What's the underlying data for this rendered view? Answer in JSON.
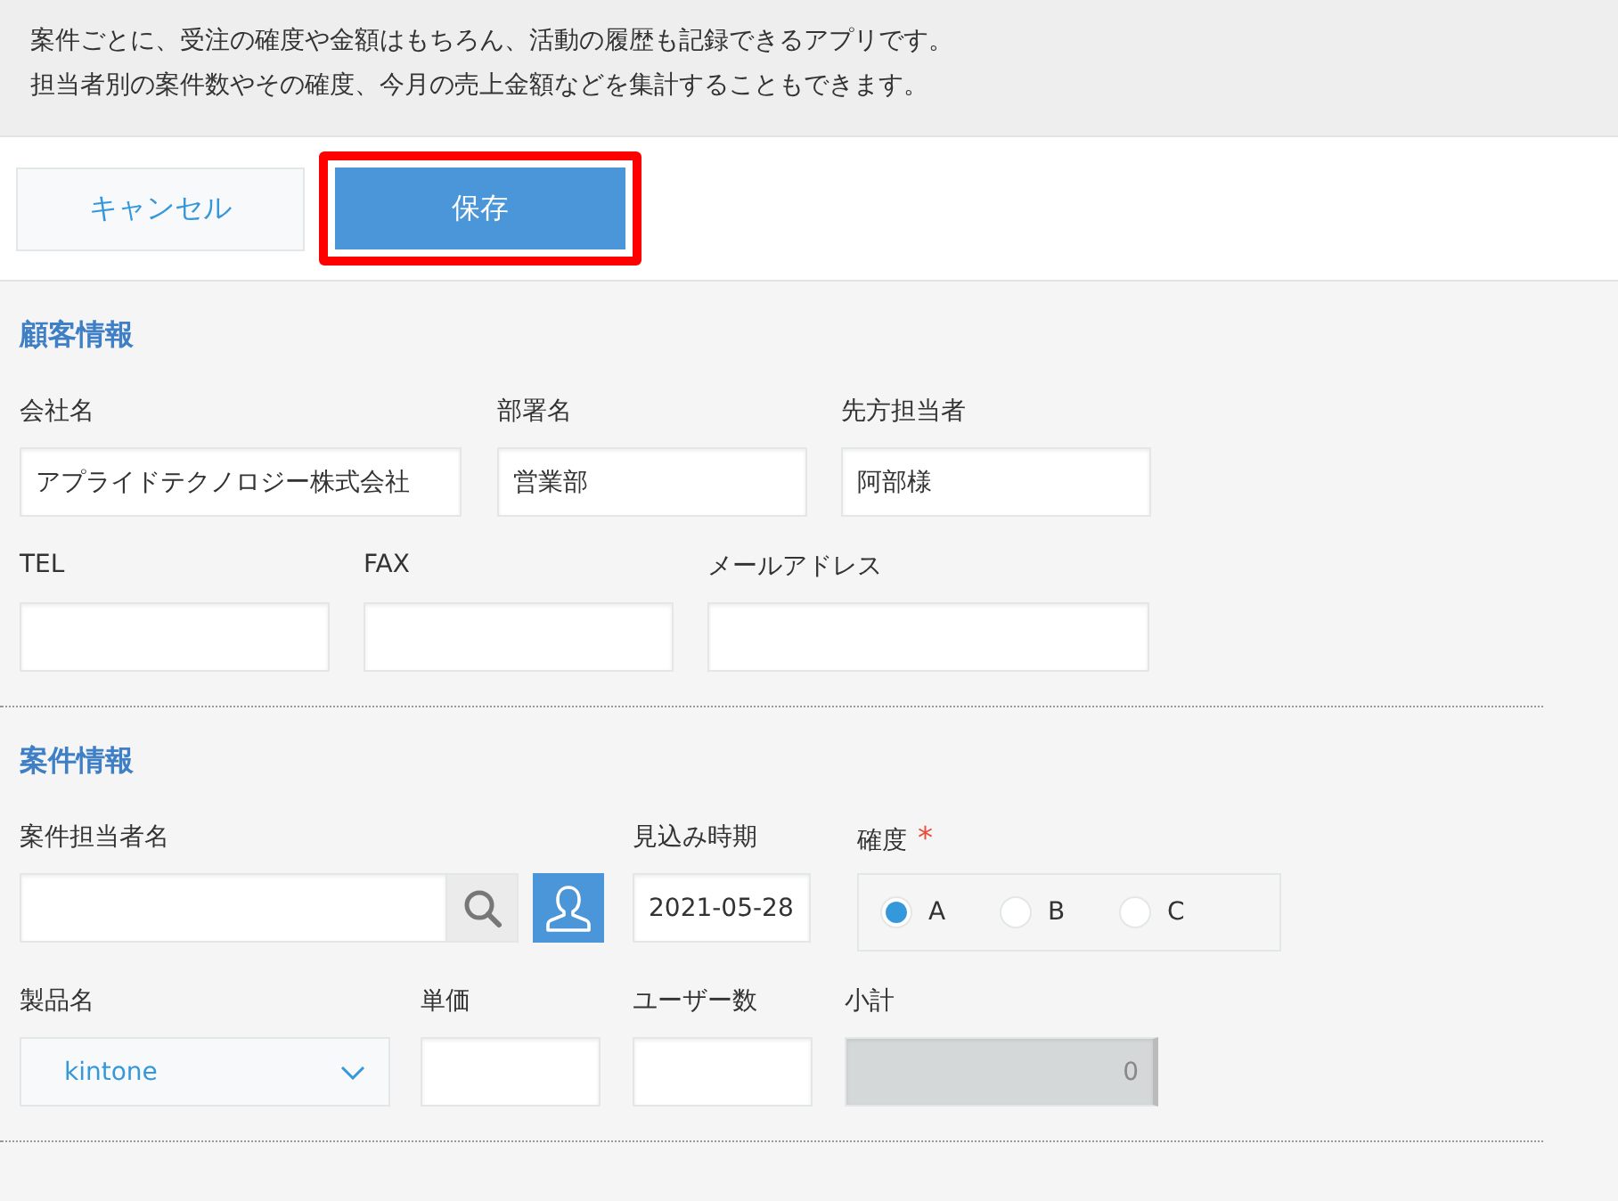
{
  "description": [
    "案件ごとに、受注の確度や金額はもちろん、活動の履歴も記録できるアプリです。",
    "担当者別の案件数やその確度、今月の売上金額などを集計することもできます。"
  ],
  "toolbar": {
    "cancel": "キャンセル",
    "save": {
      "label": "保存",
      "highlighted": true
    }
  },
  "sections": [
    {
      "title": "顧客情報",
      "groups": [
        {
          "fields": [
            {
              "kind": "text",
              "label": "会社名",
              "value": "アプライドテクノロジー株式会社"
            },
            {
              "kind": "text",
              "label": "部署名",
              "value": "営業部"
            },
            {
              "kind": "text",
              "label": "先方担当者",
              "value": "阿部様"
            }
          ]
        },
        {
          "fields": [
            {
              "kind": "text",
              "label": "TEL"
            },
            {
              "kind": "text",
              "label": "FAX"
            },
            {
              "kind": "text",
              "label": "メールアドレス"
            }
          ]
        }
      ]
    },
    {
      "title": "案件情報",
      "groups": [
        {
          "fields": [
            {
              "kind": "user",
              "label": "案件担当者名"
            },
            {
              "kind": "date",
              "label": "見込み時期",
              "value": "2021-05-28"
            },
            {
              "kind": "radio",
              "label": "確度",
              "required_mark": "*",
              "options": [
                {
                  "label": "A",
                  "selected": true
                },
                {
                  "label": "B",
                  "selected": false
                },
                {
                  "label": "C",
                  "selected": false
                }
              ]
            }
          ]
        },
        {
          "fields": [
            {
              "kind": "dropdown",
              "label": "製品名",
              "value": "kintone"
            },
            {
              "kind": "text",
              "label": "単価"
            },
            {
              "kind": "text",
              "label": "ユーザー数"
            },
            {
              "kind": "calc",
              "label": "小計",
              "value": "0"
            }
          ]
        }
      ]
    }
  ]
}
